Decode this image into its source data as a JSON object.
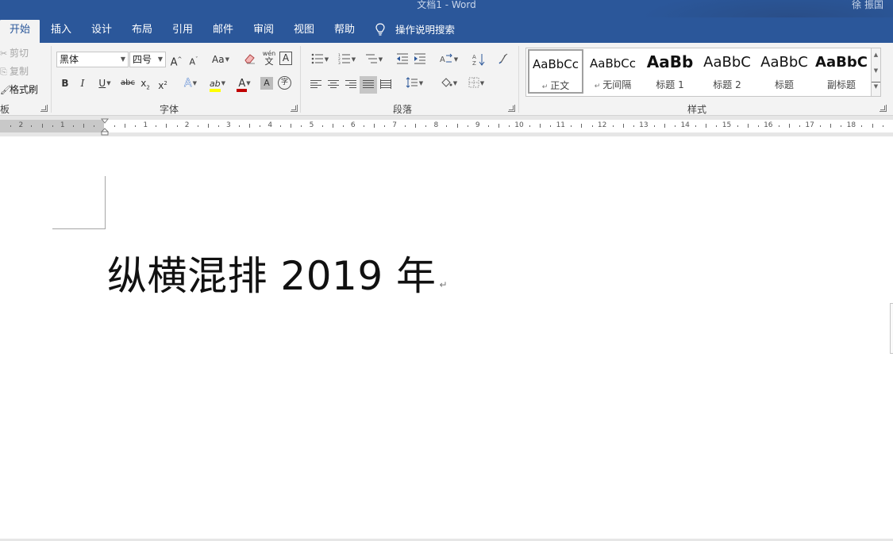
{
  "titlebar": {
    "doc_title": "文档1  -  Word",
    "user": "徐 振国"
  },
  "tabs": [
    "开始",
    "插入",
    "设计",
    "布局",
    "引用",
    "邮件",
    "审阅",
    "视图",
    "帮助"
  ],
  "tell_me": "操作说明搜索",
  "clipboard": {
    "cut": "剪切",
    "copy": "复制",
    "format_painter": "格式刷",
    "label": "板"
  },
  "font": {
    "family": "黑体",
    "size": "四号",
    "grow": "A",
    "shrink": "A",
    "change_case": "Aa",
    "phonetic": "wén",
    "phonetic_char": "文",
    "char_border": "A",
    "bold": "B",
    "italic": "I",
    "underline": "U",
    "strikethrough": "abc",
    "subscript": "x",
    "subscript_mark": "2",
    "superscript": "x",
    "superscript_mark": "2",
    "text_effects": "A",
    "highlight": "ab",
    "font_color": "A",
    "char_shading": "A",
    "enclose": "字",
    "label": "字体"
  },
  "paragraph": {
    "label": "段落",
    "sort": "A",
    "sort2": "Z"
  },
  "styles": {
    "label": "样式",
    "items": [
      {
        "sample": "AaBbCc",
        "name": "正文"
      },
      {
        "sample": "AaBbCc",
        "name": "无间隔"
      },
      {
        "sample": "AaBb",
        "name": "标题 1"
      },
      {
        "sample": "AaBbC",
        "name": "标题 2"
      },
      {
        "sample": "AaBbC",
        "name": "标题"
      },
      {
        "sample": "AaBbC",
        "name": "副标题"
      }
    ]
  },
  "ruler": {
    "left_labels": [
      "2",
      "1"
    ],
    "right_labels": [
      "1",
      "2",
      "3",
      "4",
      "5",
      "6",
      "7",
      "8",
      "9",
      "10",
      "11",
      "12",
      "13",
      "14",
      "15",
      "16",
      "17",
      "18"
    ]
  },
  "document": {
    "text": "纵横混排 2019 年",
    "para_mark": "↵"
  },
  "colors": {
    "brand": "#2b579a",
    "ribbon": "#f3f3f3",
    "font_color_bar": "#c00000",
    "highlight_bar": "#ffff00"
  }
}
